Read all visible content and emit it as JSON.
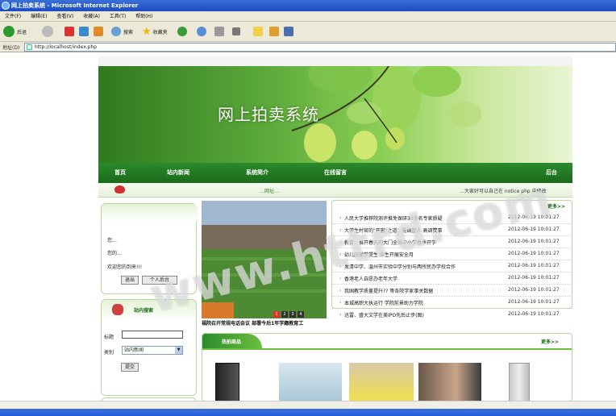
{
  "window": {
    "title": "网上拍卖系统 - Microsoft Internet Explorer"
  },
  "menu": [
    "文件(F)",
    "编辑(E)",
    "查看(V)",
    "收藏(A)",
    "工具(T)",
    "帮助(H)"
  ],
  "toolbar": {
    "back_label": "后退",
    "search_label": "搜索",
    "favorites_label": "收藏夹"
  },
  "address": {
    "label": "地址(D)",
    "url": "http://localhost/index.php"
  },
  "banner": {
    "title": "网上拍卖系统"
  },
  "nav": [
    "首页",
    "站内新闻",
    "系统简介",
    "在线留言",
    "后台"
  ],
  "notice": {
    "text": "…网址…",
    "tail": "…大家好可以自己在 notice php 中修改"
  },
  "login": {
    "line1": "您…",
    "line2": "您的…",
    "welcome": "欢迎您的到来!!!",
    "logout_button": "退出",
    "backend_button": "个人后台"
  },
  "search": {
    "title": "站内搜索",
    "title_label": "标题",
    "category_label": "类别",
    "category_value": "站内新闻",
    "submit_button": "提交"
  },
  "slideshow": {
    "caption": "福院召开常规电话会议 部署今后1年学籍教育工",
    "pages": [
      "1",
      "2",
      "3",
      "4"
    ]
  },
  "news": {
    "more": "更多>>",
    "items": [
      {
        "title": "人民大学推荐院测评推免保研30多名专家质疑",
        "date": "2012-06-19 10:01:27"
      },
      {
        "title": "大学生村官的\"开窗\"之道：能调整人 高调赞事",
        "date": "2012-06-19 10:01:27"
      },
      {
        "title": "教育：推开春天的大门全县中小学春季开学",
        "date": "2012-06-19 10:01:27"
      },
      {
        "title": "幼儿园童学提生 师生开展安全月",
        "date": "2012-06-19 10:01:27"
      },
      {
        "title": "发清中学、温州市实验中学分别与两所民办学校合作",
        "date": "2012-06-19 10:01:27"
      },
      {
        "title": "香港老人自愿办老年大学",
        "date": "2012-06-19 10:01:27"
      },
      {
        "title": "我国教学质量提升?? 等各院学家事关数据",
        "date": "2012-06-19 10:01:27"
      },
      {
        "title": "本城高职大执运行 学院前景助力学院",
        "date": "2012-06-19 10:01:27"
      },
      {
        "title": "迅雷、盛大文学在美IPO先后止步(图)",
        "date": "2012-06-19 10:01:27"
      }
    ]
  },
  "hot": {
    "title": "热拍商品",
    "more": "更多>>"
  },
  "watermark": "www.httrd.com",
  "colors": {
    "nav_green": "#1b6b1b",
    "border_green": "#b6d8a0",
    "title_blue": "#245edb"
  }
}
